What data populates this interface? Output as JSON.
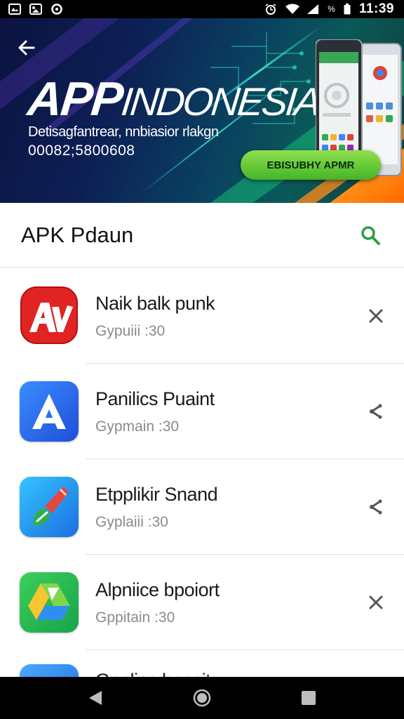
{
  "status_bar": {
    "time": "11:39",
    "battery_text": "%",
    "icons": [
      "gallery-icon",
      "image-icon",
      "sync-icon",
      "alarm-icon",
      "wifi-icon",
      "signal-icon",
      "battery-icon"
    ]
  },
  "banner": {
    "title_big": "APP",
    "title_rest": "INDONESIA",
    "subtitle_line1": "Detisagfantrear, nnbiasior rlakgn",
    "subtitle_line2": "00082;5800608",
    "cta_label": "EBISUBHY APMR"
  },
  "list": {
    "title": "APK Pdaun",
    "items": [
      {
        "name": "Naik balk punk",
        "meta": "Gypuiii :30",
        "icon": "av-app-icon",
        "action_icon": "close-icon"
      },
      {
        "name": "Panilics Puaint",
        "meta": "Gypmain :30",
        "icon": "a-app-icon",
        "action_icon": "share-icon"
      },
      {
        "name": "Etpplikir Snand",
        "meta": "Gyplaiii :30",
        "icon": "brush-app-icon",
        "action_icon": "share-icon"
      },
      {
        "name": "Alpniice bpoiort",
        "meta": "Gppitain :30",
        "icon": "drive-app-icon",
        "action_icon": "close-icon"
      }
    ],
    "partial_item": {
      "name": "Gpplios bposit"
    }
  },
  "nav_bar": {
    "icons": [
      "back-icon",
      "home-icon",
      "recents-icon"
    ]
  },
  "colors": {
    "accent": "#2e9d3f",
    "cta": "#5cc432",
    "banner_dark": "#0b1340"
  }
}
